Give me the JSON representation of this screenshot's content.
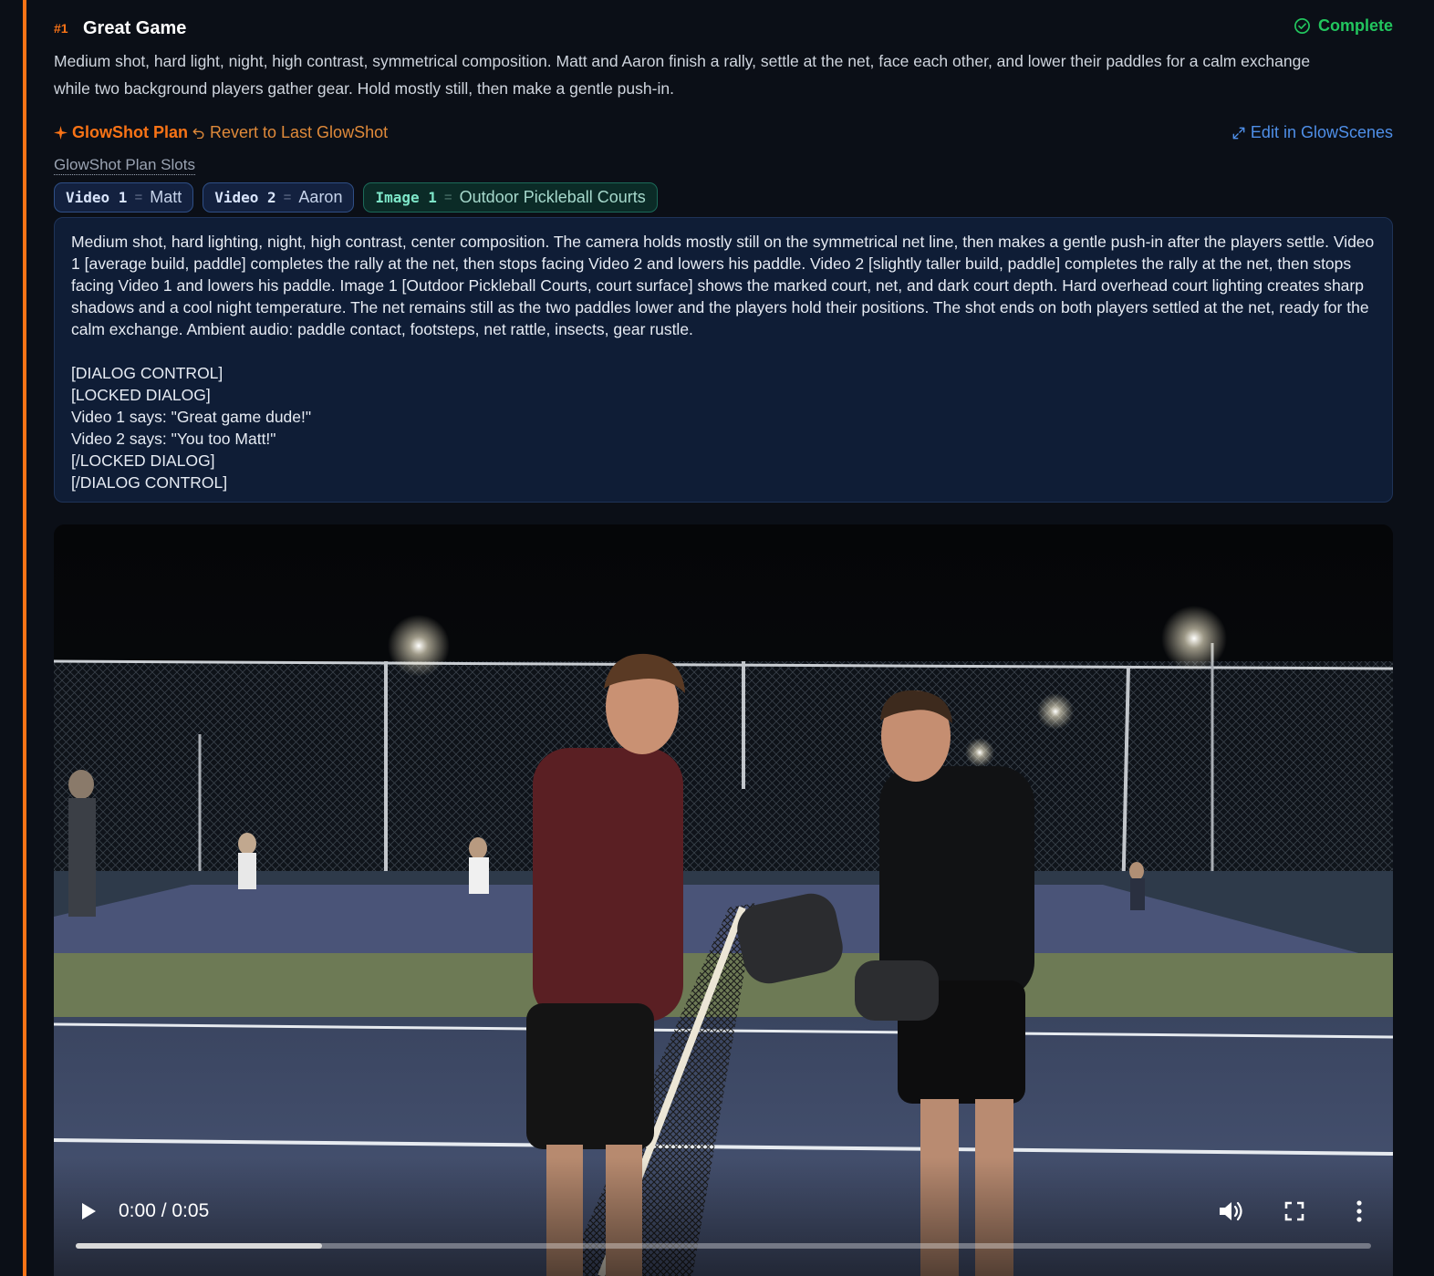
{
  "shot": {
    "number": "#1",
    "title": "Great Game",
    "status": "Complete",
    "summary": "Medium shot, hard light, night, high contrast, symmetrical composition. Matt and Aaron finish a rally, settle at the net, face each other, and lower their paddles for a calm exchange while two background players gather gear. Hold mostly still, then make a gentle push-in."
  },
  "plan": {
    "label": "GlowShot Plan",
    "revert_label": "Revert to Last GlowShot",
    "edit_label": "Edit in GlowScenes",
    "slots_label": "GlowShot Plan Slots"
  },
  "slots": [
    {
      "key": "Video 1",
      "value": "Matt"
    },
    {
      "key": "Video 2",
      "value": "Aaron"
    },
    {
      "key": "Image 1",
      "value": "Outdoor Pickleball Courts"
    }
  ],
  "prompt": {
    "body": "Medium shot, hard lighting, night, high contrast, center composition. The camera holds mostly still on the symmetrical net line, then makes a gentle push-in after the players settle. Video 1 [average build, paddle] completes the rally at the net, then stops facing Video 2 and lowers his paddle. Video 2 [slightly taller build, paddle] completes the rally at the net, then stops facing Video 1 and lowers his paddle. Image 1 [Outdoor Pickleball Courts, court surface] shows the marked court, net, and dark court depth. Hard overhead court lighting creates sharp shadows and a cool night temperature. The net remains still as the two paddles lower and the players hold their positions. The shot ends on both players settled at the net, ready for the calm exchange. Ambient audio: paddle contact, footsteps, net rattle, insects, gear rustle.",
    "dialog_lines": [
      "[DIALOG CONTROL]",
      "[LOCKED DIALOG]",
      "Video 1 says: \"Great game dude!\"",
      "Video 2 says: \"You too Matt!\"",
      "[/LOCKED DIALOG]",
      "[/DIALOG CONTROL]"
    ]
  },
  "video": {
    "time": "0:00 / 0:05",
    "progress": 0.19
  },
  "colors": {
    "accent": "#f97316",
    "complete": "#22c55e",
    "link": "#4f8fe8",
    "background": "#0b0f17"
  },
  "icons": [
    "sparkle-icon",
    "undo-icon",
    "expand-icon",
    "check-circle-icon",
    "play-icon",
    "volume-icon",
    "fullscreen-icon",
    "more-vertical-icon"
  ]
}
